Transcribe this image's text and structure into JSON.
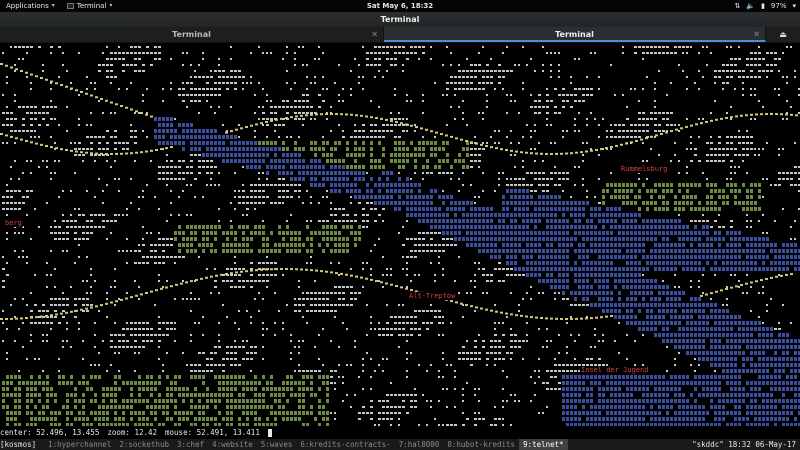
{
  "topbar": {
    "applications_label": "Applications",
    "app_menu_label": "Terminal",
    "clock": "Sat May 6, 18:32",
    "battery": "97%",
    "icons": [
      "network-icon",
      "volume-icon",
      "battery-icon",
      "system-menu-icon"
    ]
  },
  "window": {
    "title": "Terminal"
  },
  "tabs": [
    {
      "label": "Terminal",
      "active": false
    },
    {
      "label": "Terminal",
      "active": true
    }
  ],
  "map": {
    "places": {
      "rummelsburg": "Rummelsburg",
      "berg": "berg",
      "alt_treptow": "Alt-Treptow",
      "insel": "Insel der Jugend"
    },
    "colors": {
      "water": "#3a4fa0",
      "park": "#6e8a45",
      "street": "#c8c8c8",
      "road": "#d6c87a",
      "label": "#d54040"
    }
  },
  "statusline": {
    "center_label": "center:",
    "center_value": "52.496, 13.455",
    "zoom_label": "zoom:",
    "zoom_value": "12.42",
    "mouse_label": "mouse:",
    "mouse_value": "52.491, 13.411"
  },
  "tmux": {
    "session": "[kosmos]",
    "windows": [
      {
        "label": "1:hyperchannel",
        "current": false
      },
      {
        "label": "2:sockethub",
        "current": false
      },
      {
        "label": "3:chef",
        "current": false
      },
      {
        "label": "4:website",
        "current": false
      },
      {
        "label": "5:waves",
        "current": false
      },
      {
        "label": "6:kredits-contracts-",
        "current": false
      },
      {
        "label": "7:hal8000",
        "current": false
      },
      {
        "label": "8:hubot-kredits",
        "current": false
      },
      {
        "label": "9:telnet*",
        "current": true
      }
    ],
    "right": "\"skddc\" 18:32 06-May-17"
  }
}
